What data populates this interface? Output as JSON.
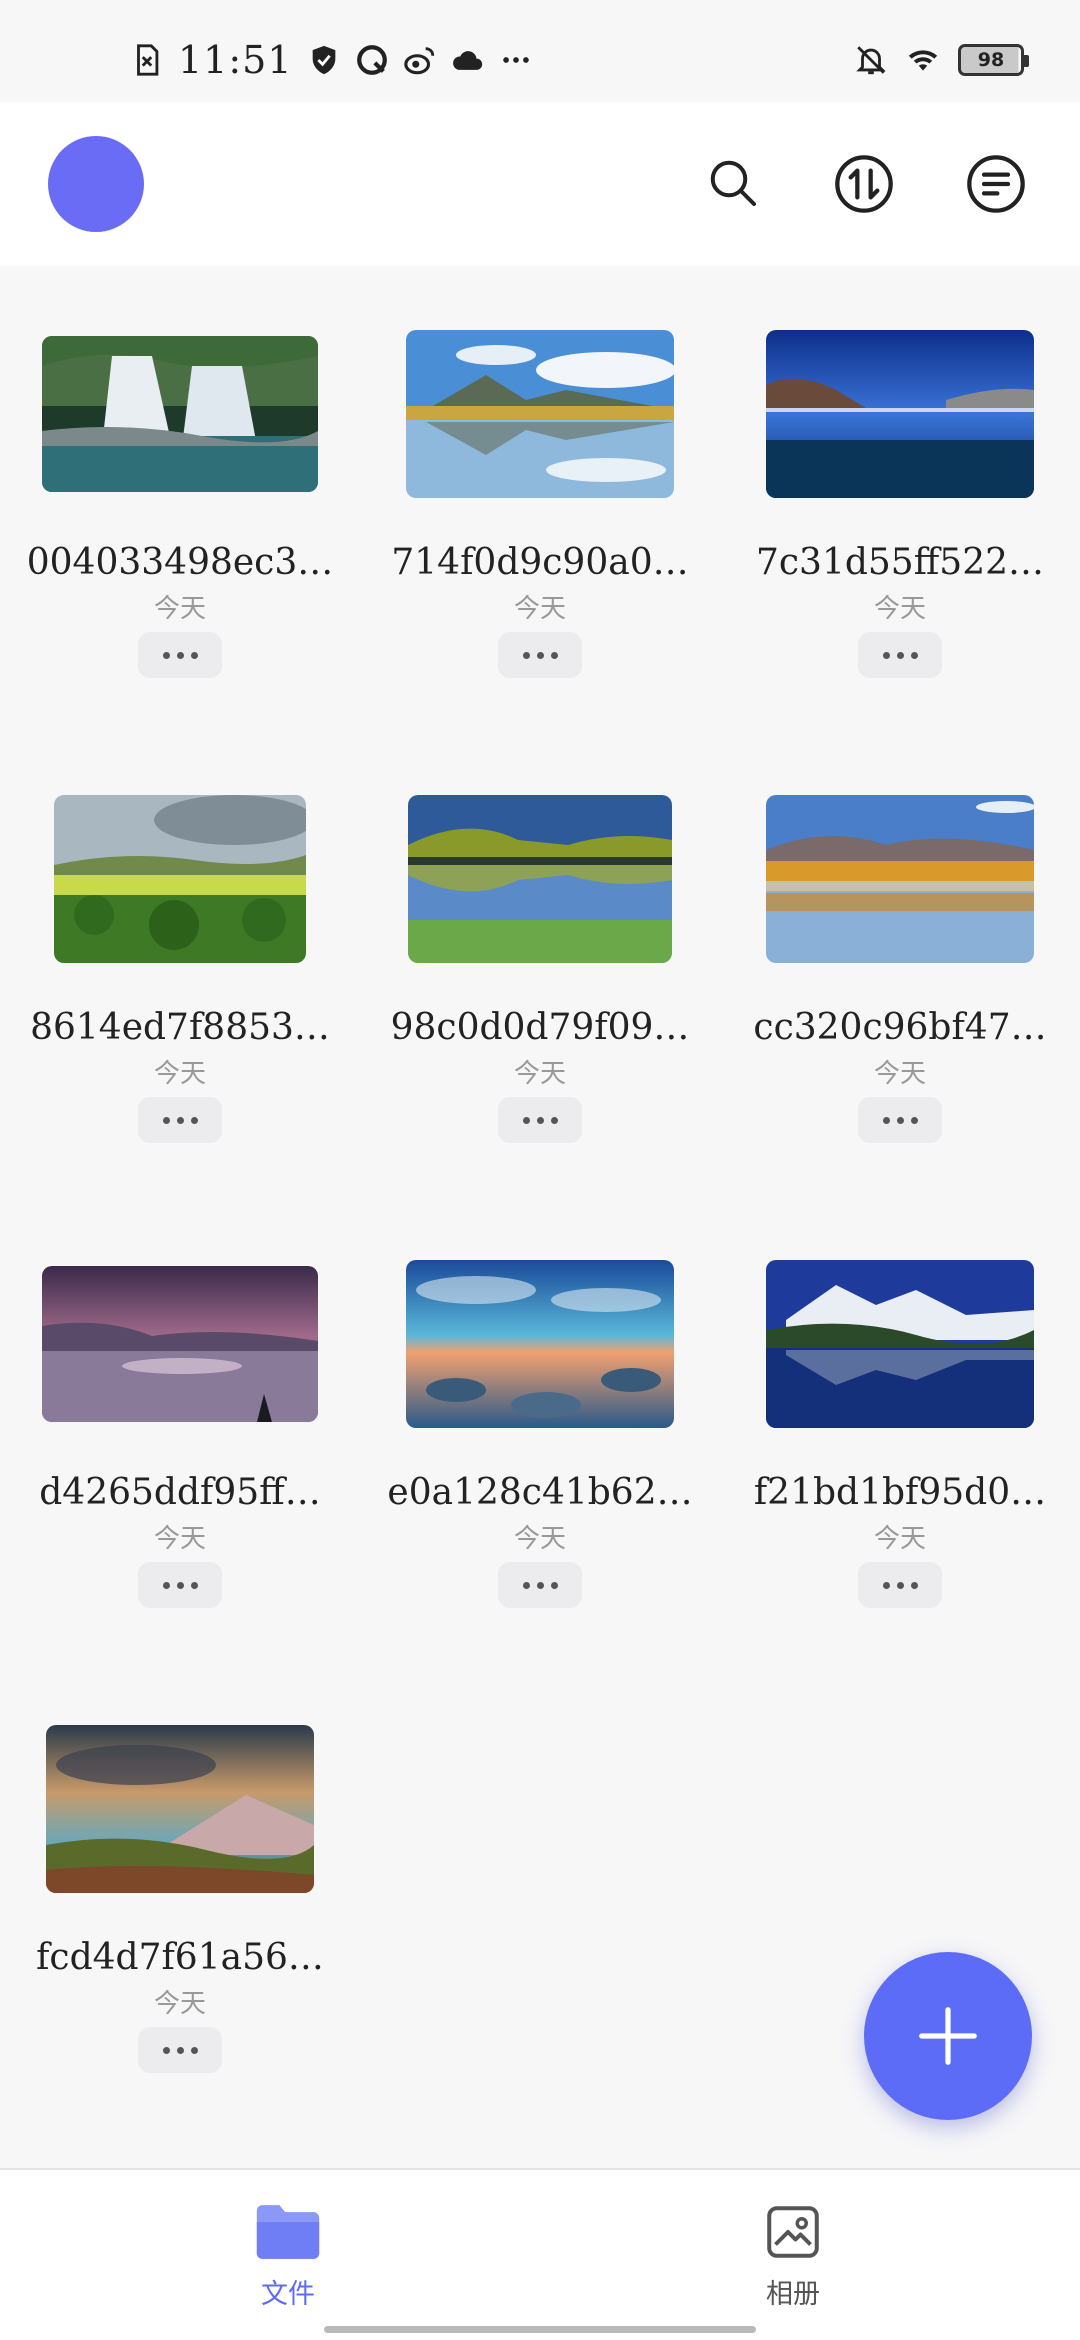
{
  "status_bar": {
    "time": "11:51",
    "left_icons": [
      "sim-error-icon",
      "shield-icon",
      "q-app-icon",
      "weibo-icon",
      "cloud-icon",
      "more-dots-icon"
    ],
    "right_icons": [
      "bell-muted-icon",
      "wifi-icon"
    ],
    "battery": "98"
  },
  "header": {
    "avatar": "avatar",
    "actions": [
      "search-icon",
      "sort-icon",
      "menu-icon"
    ]
  },
  "files": [
    {
      "name": "004033498ec3…",
      "date": "今天",
      "thumb": "waterfall"
    },
    {
      "name": "714f0d9c90a0…",
      "date": "今天",
      "thumb": "mountain-lake"
    },
    {
      "name": "7c31d55ff522…",
      "date": "今天",
      "thumb": "blue-lake"
    },
    {
      "name": "8614ed7f8853…",
      "date": "今天",
      "thumb": "green-fields"
    },
    {
      "name": "98c0d0d79f09…",
      "date": "今天",
      "thumb": "reflection-hills"
    },
    {
      "name": "cc320c96bf47…",
      "date": "今天",
      "thumb": "autumn-trees"
    },
    {
      "name": "d4265ddf95ff…",
      "date": "今天",
      "thumb": "purple-dusk"
    },
    {
      "name": "e0a128c41b62…",
      "date": "今天",
      "thumb": "rocky-sunset"
    },
    {
      "name": "f21bd1bf95d0…",
      "date": "今天",
      "thumb": "snowy-mountain-lake"
    },
    {
      "name": "fcd4d7f61a56…",
      "date": "今天",
      "thumb": "mountain-sunbeams"
    }
  ],
  "fab": {
    "icon": "plus-icon",
    "color": "#5c6cf7"
  },
  "bottom_nav": {
    "items": [
      {
        "label": "文件",
        "icon": "folder-icon",
        "active": true
      },
      {
        "label": "相册",
        "icon": "album-icon",
        "active": false
      }
    ],
    "active_color": "#5c6cf7",
    "inactive_color": "#555555"
  }
}
